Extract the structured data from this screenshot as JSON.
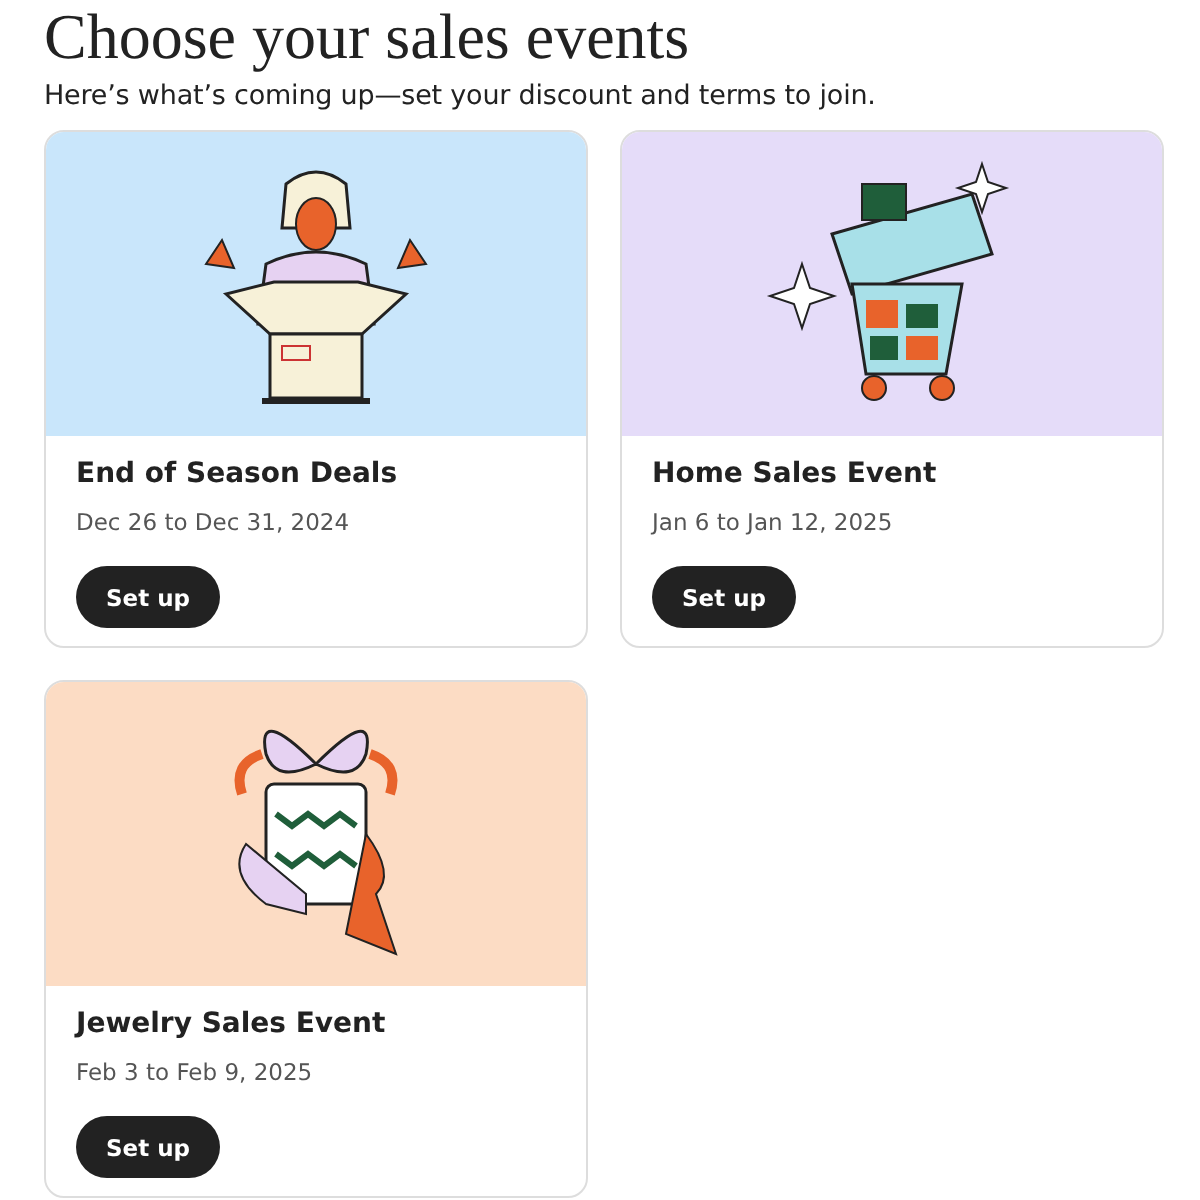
{
  "heading": "Choose your sales events",
  "subtitle": "Here’s what’s coming up—set your discount and terms to join.",
  "events": [
    {
      "kind": "box",
      "title": "End of Season Deals",
      "dates": "Dec 26 to Dec 31, 2024",
      "button": "Set up"
    },
    {
      "kind": "cart",
      "title": "Home Sales Event",
      "dates": "Jan 6 to Jan 12, 2025",
      "button": "Set up"
    },
    {
      "kind": "gift",
      "title": "Jewelry Sales Event",
      "dates": "Feb 3 to Feb 9, 2025",
      "button": "Set up"
    }
  ]
}
